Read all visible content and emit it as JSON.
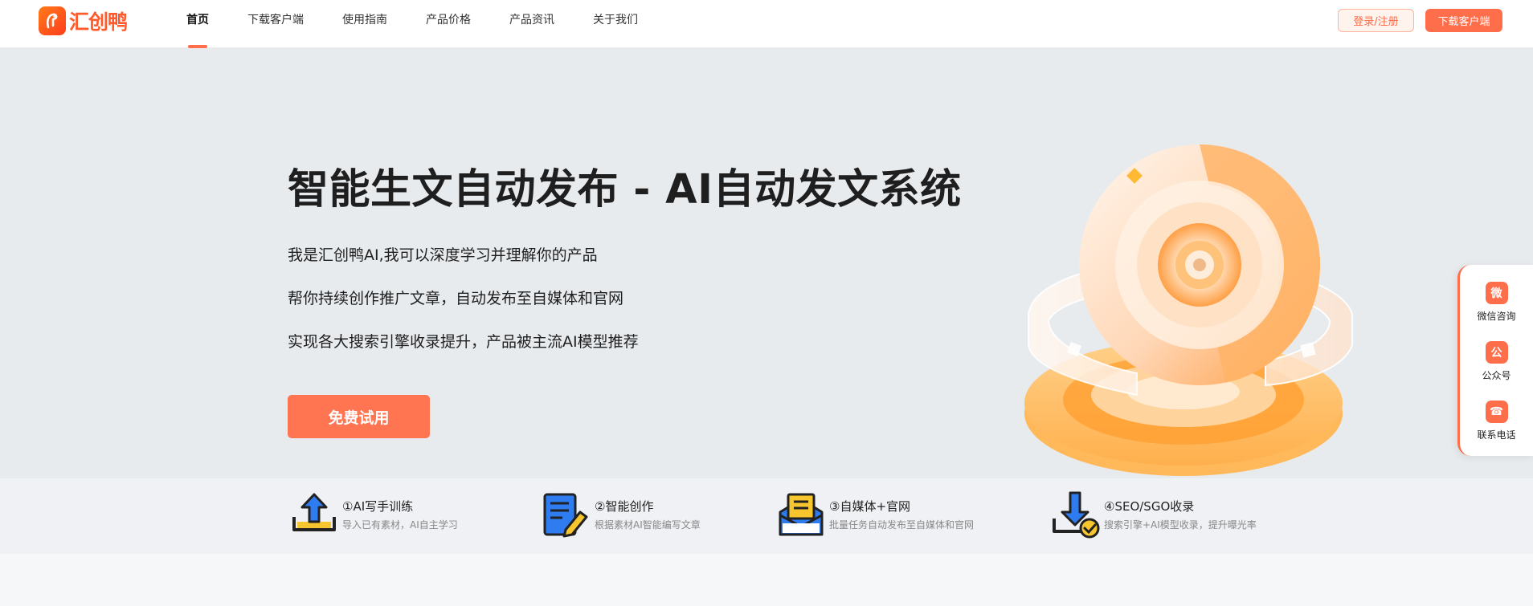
{
  "brand": {
    "logo_text": "汇创鸭"
  },
  "nav": {
    "items": [
      {
        "label": "首页"
      },
      {
        "label": "下载客户端"
      },
      {
        "label": "使用指南"
      },
      {
        "label": "产品价格"
      },
      {
        "label": "产品资讯"
      },
      {
        "label": "关于我们"
      }
    ],
    "login_label": "登录/注册",
    "download_label": "下载客户端"
  },
  "hero": {
    "title": "智能生文自动发布 - AI自动发文系统",
    "lines": [
      "我是汇创鸭AI,我可以深度学习并理解你的产品",
      "帮你持续创作推广文章，自动发布至自媒体和官网",
      "实现各大搜索引擎收录提升，产品被主流AI模型推荐"
    ],
    "cta_label": "免费试用"
  },
  "features": [
    {
      "icon": "upload-icon",
      "title": "①AI写手训练",
      "desc": "导入已有素材，AI自主学习"
    },
    {
      "icon": "document-edit-icon",
      "title": "②智能创作",
      "desc": "根据素材AI智能编写文章"
    },
    {
      "icon": "envelope-icon",
      "title": "③自媒体+官网",
      "desc": "批量任务自动发布至自媒体和官网"
    },
    {
      "icon": "download-check-icon",
      "title": "④SEO/SGO收录",
      "desc": "搜索引擎+AI模型收录，提升曝光率"
    }
  ],
  "side": {
    "items": [
      {
        "icon_char": "微",
        "icon": "wechat-icon",
        "label": "微信咨询"
      },
      {
        "icon_char": "公",
        "icon": "official-account-icon",
        "label": "公众号"
      },
      {
        "icon_char": "☎",
        "icon": "phone-icon",
        "label": "联系电话"
      }
    ]
  },
  "colors": {
    "accent": "#ff6e4a",
    "hero_bg": "#e8ebee",
    "feature_blue": "#2f7cf0",
    "feature_yellow": "#f7c62f"
  }
}
